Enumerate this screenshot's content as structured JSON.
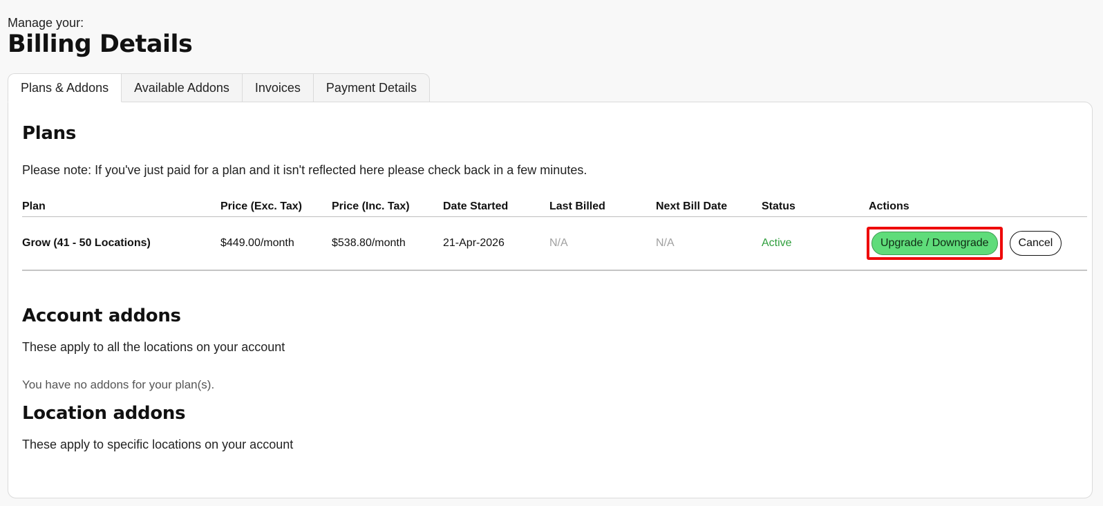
{
  "header": {
    "subtitle": "Manage your:",
    "title": "Billing Details"
  },
  "tabs": [
    {
      "label": "Plans & Addons",
      "active": true
    },
    {
      "label": "Available Addons",
      "active": false
    },
    {
      "label": "Invoices",
      "active": false
    },
    {
      "label": "Payment Details",
      "active": false
    }
  ],
  "plans": {
    "title": "Plans",
    "note": "Please note: If you've just paid for a plan and it isn't reflected here please check back in a few minutes.",
    "columns": [
      "Plan",
      "Price (Exc. Tax)",
      "Price (Inc. Tax)",
      "Date Started",
      "Last Billed",
      "Next Bill Date",
      "Status",
      "Actions"
    ],
    "rows": [
      {
        "plan": "Grow (41 - 50 Locations)",
        "price_exc": "$449.00/month",
        "price_inc": "$538.80/month",
        "date_started": "21-Apr-2026",
        "last_billed": "N/A",
        "next_bill": "N/A",
        "status": "Active",
        "upgrade_label": "Upgrade / Downgrade",
        "cancel_label": "Cancel"
      }
    ]
  },
  "account_addons": {
    "title": "Account addons",
    "description": "These apply to all the locations on your account",
    "empty": "You have no addons for your plan(s)."
  },
  "location_addons": {
    "title": "Location addons",
    "description": "These apply to specific locations on your account"
  },
  "colors": {
    "status_active": "#2e9e3c",
    "upgrade_button": "#5fdc7a",
    "highlight_border": "#ee0a0a"
  }
}
